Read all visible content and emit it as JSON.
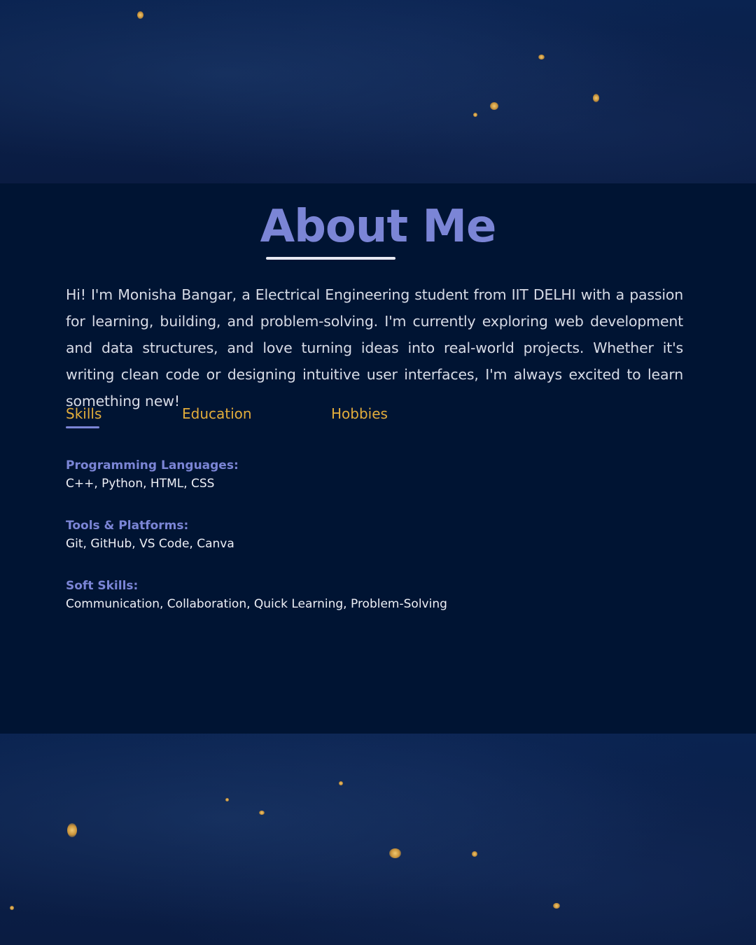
{
  "about": {
    "title": "About Me",
    "intro": "Hi! I'm Monisha Bangar, a Electrical Engineering student from IIT DELHI with a passion for learning, building, and problem-solving. I'm currently exploring web development and data structures, and love turning ideas into real-world projects. Whether it's writing clean code or designing intuitive user interfaces, I'm always excited to learn something new!"
  },
  "tabs": [
    {
      "label": "Skills",
      "active": true
    },
    {
      "label": "Education",
      "active": false
    },
    {
      "label": "Hobbies",
      "active": false
    }
  ],
  "skills": [
    {
      "heading": "Programming Languages:",
      "values": "C++, Python, HTML, CSS"
    },
    {
      "heading": "Tools & Platforms:",
      "values": "Git, GitHub, VS Code, Canva"
    },
    {
      "heading": "Soft Skills:",
      "values": "Communication, Collaboration, Quick Learning, Problem-Solving"
    }
  ],
  "colors": {
    "accent": "#7b85d6",
    "tab": "#e3ad3b",
    "panel": "#001433"
  }
}
